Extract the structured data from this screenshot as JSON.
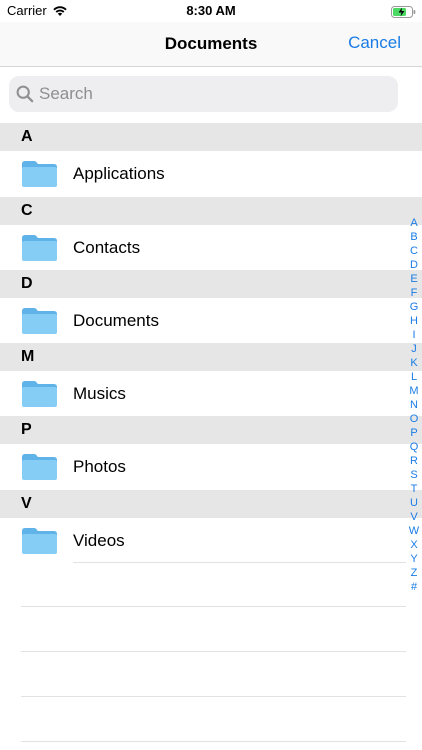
{
  "status": {
    "carrier": "Carrier",
    "time": "8:30 AM"
  },
  "nav": {
    "title": "Documents",
    "cancel_label": "Cancel"
  },
  "search": {
    "placeholder": "Search"
  },
  "sections": [
    {
      "letter": "A",
      "item": "Applications"
    },
    {
      "letter": "C",
      "item": "Contacts"
    },
    {
      "letter": "D",
      "item": "Documents"
    },
    {
      "letter": "M",
      "item": "Musics"
    },
    {
      "letter": "P",
      "item": "Photos"
    },
    {
      "letter": "V",
      "item": "Videos"
    }
  ],
  "index": [
    "A",
    "B",
    "C",
    "D",
    "E",
    "F",
    "G",
    "H",
    "I",
    "J",
    "K",
    "L",
    "M",
    "N",
    "O",
    "P",
    "Q",
    "R",
    "S",
    "T",
    "U",
    "V",
    "W",
    "X",
    "Y",
    "Z",
    "#"
  ],
  "colors": {
    "accent": "#1a7ce5",
    "folder": "#7ac8f5",
    "header_bg": "#e6e6e6"
  },
  "icons": {
    "folder": "folder-icon",
    "search": "search-icon",
    "wifi": "wifi-icon",
    "battery": "battery-charging-icon"
  }
}
